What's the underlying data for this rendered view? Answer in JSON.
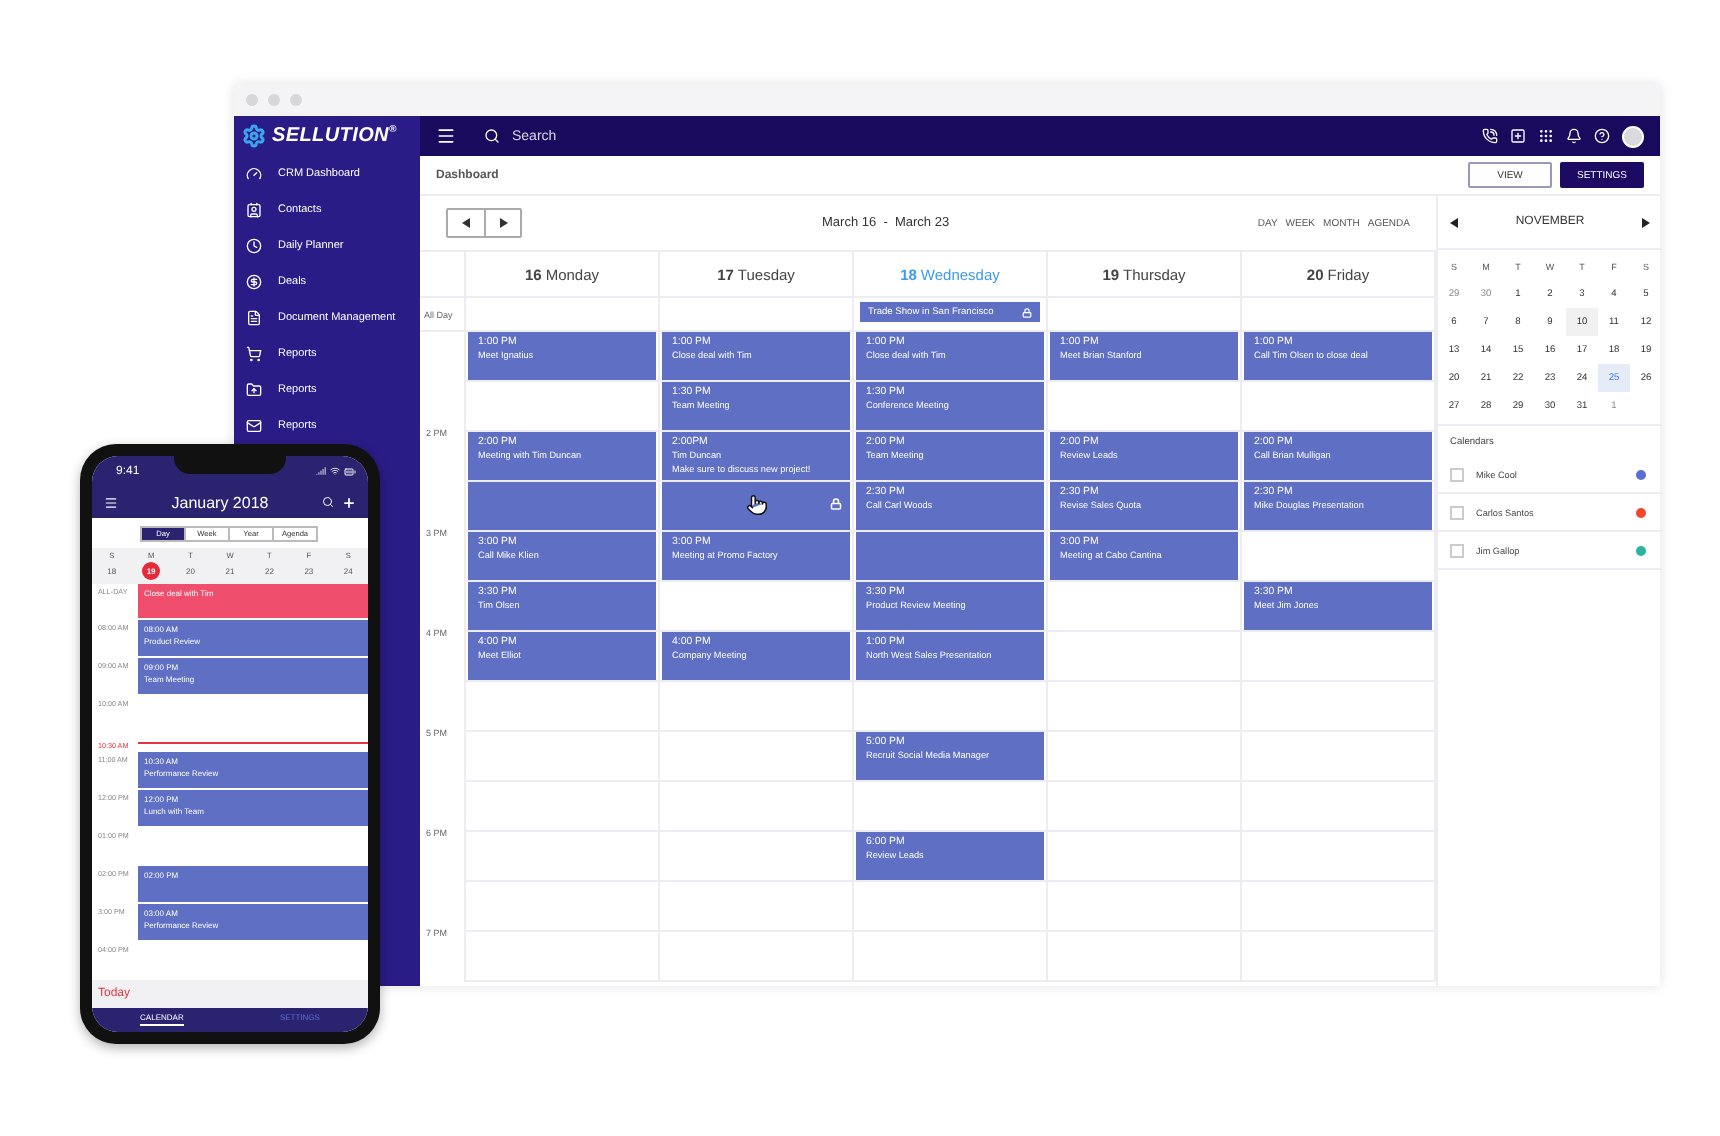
{
  "brand": {
    "name": "SELLUTION$^{®}$"
  },
  "search": {
    "placeholder": "Search"
  },
  "sidebar": {
    "items": [
      {
        "label": "CRM Dashboard"
      },
      {
        "label": "Contacts"
      },
      {
        "label": "Daily Planner"
      },
      {
        "label": "Deals"
      },
      {
        "label": "Document Management"
      },
      {
        "label": "Reports"
      },
      {
        "label": "Reports"
      },
      {
        "label": "Reports"
      }
    ]
  },
  "page_title": "Dashboard",
  "header_buttons": [
    {
      "label": "VIEW",
      "kind": "outline"
    },
    {
      "label": "SETTINGS",
      "kind": "filled"
    }
  ],
  "calendar": {
    "range": "March 16  -  March 23",
    "views": [
      {
        "label": "DAY",
        "selected": false
      },
      {
        "label": "WEEK",
        "selected": false
      },
      {
        "label": "MONTH",
        "selected": false
      },
      {
        "label": "AGENDA",
        "selected": false
      }
    ],
    "all_day_label": "All Day",
    "hour_labels": [
      "2 PM",
      "3 PM",
      "4 PM",
      "5 PM",
      "6 PM",
      "7 PM"
    ],
    "days": [
      {
        "number": "16",
        "name": "Monday",
        "today": false,
        "slots": [
          {
            "kind": "event",
            "time": "1:00 PM",
            "title": "Meet Ignatius"
          },
          {
            "kind": "empty"
          },
          {
            "kind": "event",
            "time": "2:00 PM",
            "title": "Meeting with Tim Duncan"
          },
          {
            "kind": "busy"
          },
          {
            "kind": "event",
            "time": "3:00 PM",
            "title": "Call  Mike Klien"
          },
          {
            "kind": "event",
            "time": "3:30 PM",
            "title": "Tim Olsen"
          },
          {
            "kind": "event",
            "time": "4:00 PM",
            "title": "Meet Elliot"
          },
          {
            "kind": "empty"
          },
          {
            "kind": "empty"
          },
          {
            "kind": "empty"
          },
          {
            "kind": "empty"
          },
          {
            "kind": "empty"
          },
          {
            "kind": "empty"
          }
        ]
      },
      {
        "number": "17",
        "name": "Tuesday",
        "today": false,
        "slots": [
          {
            "kind": "event",
            "time": "1:00 PM",
            "title": "Close deal with Tim"
          },
          {
            "kind": "event",
            "time": "1:30 PM",
            "title": "Team Meeting"
          },
          {
            "kind": "event",
            "time": "2:00PM",
            "title": "Tim Duncan",
            "note": "Make sure to discuss new project!"
          },
          {
            "kind": "locked"
          },
          {
            "kind": "event",
            "time": "3:00 PM",
            "title": "Meeting at Promo Factory"
          },
          {
            "kind": "empty"
          },
          {
            "kind": "event",
            "time": "4:00 PM",
            "title": "Company Meeting"
          },
          {
            "kind": "empty"
          },
          {
            "kind": "empty"
          },
          {
            "kind": "empty"
          },
          {
            "kind": "empty"
          },
          {
            "kind": "empty"
          },
          {
            "kind": "empty"
          }
        ]
      },
      {
        "number": "18",
        "name": "Wednesday",
        "today": true,
        "all_day": {
          "title": "Trade Show in San Francisco",
          "locked": true
        },
        "slots": [
          {
            "kind": "event",
            "time": "1:00 PM",
            "title": "Close deal with Tim"
          },
          {
            "kind": "event",
            "time": "1:30 PM",
            "title": "Conference Meeting"
          },
          {
            "kind": "event",
            "time": "2:00 PM",
            "title": "Team Meeting"
          },
          {
            "kind": "event",
            "time": "2:30 PM",
            "title": "Call Carl Woods"
          },
          {
            "kind": "busy"
          },
          {
            "kind": "event",
            "time": "3:30 PM",
            "title": "Product Review Meeting"
          },
          {
            "kind": "event",
            "time": "1:00 PM",
            "title": "North West Sales Presentation"
          },
          {
            "kind": "empty"
          },
          {
            "kind": "event",
            "time": "5:00 PM",
            "title": "Recruit Social Media Manager"
          },
          {
            "kind": "empty"
          },
          {
            "kind": "event",
            "time": "6:00 PM",
            "title": "Review Leads"
          },
          {
            "kind": "empty"
          },
          {
            "kind": "empty"
          }
        ]
      },
      {
        "number": "19",
        "name": "Thursday",
        "today": false,
        "slots": [
          {
            "kind": "event",
            "time": "1:00 PM",
            "title": "Meet Brian Stanford"
          },
          {
            "kind": "empty"
          },
          {
            "kind": "event",
            "time": "2:00 PM",
            "title": "Review Leads"
          },
          {
            "kind": "event",
            "time": "2:30 PM",
            "title": "Revise Sales Quota"
          },
          {
            "kind": "event",
            "time": "3:00 PM",
            "title": "Meeting at Cabo Cantina"
          },
          {
            "kind": "empty"
          },
          {
            "kind": "empty"
          },
          {
            "kind": "empty"
          },
          {
            "kind": "empty"
          },
          {
            "kind": "empty"
          },
          {
            "kind": "empty"
          },
          {
            "kind": "empty"
          },
          {
            "kind": "empty"
          }
        ]
      },
      {
        "number": "20",
        "name": "Friday",
        "today": false,
        "slots": [
          {
            "kind": "event",
            "time": "1:00 PM",
            "title": "Call Tim Olsen to close deal"
          },
          {
            "kind": "empty"
          },
          {
            "kind": "event",
            "time": "2:00 PM",
            "title": "Call Brian Mulligan"
          },
          {
            "kind": "event",
            "time": "2:30 PM",
            "title": "Mike Douglas Presentation"
          },
          {
            "kind": "empty"
          },
          {
            "kind": "event",
            "time": "3:30 PM",
            "title": "Meet Jim Jones"
          },
          {
            "kind": "empty"
          },
          {
            "kind": "empty"
          },
          {
            "kind": "empty"
          },
          {
            "kind": "empty"
          },
          {
            "kind": "empty"
          },
          {
            "kind": "empty"
          },
          {
            "kind": "empty"
          }
        ]
      }
    ]
  },
  "mini_calendar": {
    "month": "NOVEMBER",
    "weekdays": [
      "S",
      "M",
      "T",
      "W",
      "T",
      "F",
      "S"
    ],
    "weeks": [
      [
        {
          "day": "29",
          "muted": true,
          "shaded": false,
          "selected": false
        },
        {
          "day": "30",
          "muted": true,
          "shaded": false,
          "selected": false
        },
        {
          "day": "1",
          "muted": false,
          "shaded": false,
          "selected": false
        },
        {
          "day": "2",
          "muted": false,
          "shaded": false,
          "selected": false
        },
        {
          "day": "3",
          "muted": false,
          "shaded": false,
          "selected": false
        },
        {
          "day": "4",
          "muted": false,
          "shaded": false,
          "selected": false
        },
        {
          "day": "5",
          "muted": false,
          "shaded": false,
          "selected": false
        }
      ],
      [
        {
          "day": "6",
          "muted": false,
          "shaded": false,
          "selected": false
        },
        {
          "day": "7",
          "muted": false,
          "shaded": false,
          "selected": false
        },
        {
          "day": "8",
          "muted": false,
          "shaded": false,
          "selected": false
        },
        {
          "day": "9",
          "muted": false,
          "shaded": false,
          "selected": false
        },
        {
          "day": "10",
          "muted": false,
          "shaded": true,
          "selected": false
        },
        {
          "day": "11",
          "muted": false,
          "shaded": false,
          "selected": false
        },
        {
          "day": "12",
          "muted": false,
          "shaded": false,
          "selected": false
        }
      ],
      [
        {
          "day": "13",
          "muted": false,
          "shaded": false,
          "selected": false
        },
        {
          "day": "14",
          "muted": false,
          "shaded": false,
          "selected": false
        },
        {
          "day": "15",
          "muted": false,
          "shaded": false,
          "selected": false
        },
        {
          "day": "16",
          "muted": false,
          "shaded": false,
          "selected": false
        },
        {
          "day": "17",
          "muted": false,
          "shaded": false,
          "selected": false
        },
        {
          "day": "18",
          "muted": false,
          "shaded": false,
          "selected": false
        },
        {
          "day": "19",
          "muted": false,
          "shaded": false,
          "selected": false
        }
      ],
      [
        {
          "day": "20",
          "muted": false,
          "shaded": false,
          "selected": false
        },
        {
          "day": "21",
          "muted": false,
          "shaded": false,
          "selected": false
        },
        {
          "day": "22",
          "muted": false,
          "shaded": false,
          "selected": false
        },
        {
          "day": "23",
          "muted": false,
          "shaded": false,
          "selected": false
        },
        {
          "day": "24",
          "muted": false,
          "shaded": false,
          "selected": false
        },
        {
          "day": "25",
          "muted": false,
          "shaded": false,
          "selected": true
        },
        {
          "day": "26",
          "muted": false,
          "shaded": false,
          "selected": false
        }
      ],
      [
        {
          "day": "27",
          "muted": false,
          "shaded": false,
          "selected": false
        },
        {
          "day": "28",
          "muted": false,
          "shaded": false,
          "selected": false
        },
        {
          "day": "29",
          "muted": false,
          "shaded": false,
          "selected": false
        },
        {
          "day": "30",
          "muted": false,
          "shaded": false,
          "selected": false
        },
        {
          "day": "31",
          "muted": false,
          "shaded": false,
          "selected": false
        },
        {
          "day": "1",
          "muted": true,
          "shaded": false,
          "selected": false
        }
      ]
    ]
  },
  "calendars": {
    "title": "Calendars",
    "items": [
      {
        "name": "Mike Cool",
        "color": "#5b6fd0",
        "checked": false
      },
      {
        "name": "Carlos Santos",
        "color": "#f2452b",
        "checked": false
      },
      {
        "name": "Jim Gallop",
        "color": "#2bb3a0",
        "checked": false
      }
    ]
  },
  "phone": {
    "clock": "9:41",
    "title": "January 2018",
    "segments": [
      {
        "label": "Day",
        "selected": true
      },
      {
        "label": "Week",
        "selected": false
      },
      {
        "label": "Year",
        "selected": false
      },
      {
        "label": "Agenda",
        "selected": false
      }
    ],
    "week": [
      {
        "letter": "S",
        "date": "18",
        "selected": false
      },
      {
        "letter": "M",
        "date": "19",
        "selected": true
      },
      {
        "letter": "T",
        "date": "20",
        "selected": false
      },
      {
        "letter": "W",
        "date": "21",
        "selected": false
      },
      {
        "letter": "T",
        "date": "22",
        "selected": false
      },
      {
        "letter": "F",
        "date": "23",
        "selected": false
      },
      {
        "letter": "S",
        "date": "24",
        "selected": false
      }
    ],
    "timeline": [
      {
        "label": "ALL-DAY",
        "kind": "allday",
        "event": {
          "title": "Close deal with Tim"
        }
      },
      {
        "label": "08:00 AM",
        "kind": "slot",
        "event": {
          "time": "08:00 AM",
          "title": "Product Review"
        }
      },
      {
        "label": "09:00 AM",
        "kind": "slot",
        "event": {
          "time": "09:00 PM",
          "title": "Team Meeting"
        }
      },
      {
        "label": "10:00 AM",
        "kind": "slot"
      },
      {
        "label": "10:30 AM",
        "kind": "now"
      },
      {
        "label": "11:00 AM",
        "kind": "slot",
        "event": {
          "time": "10:30 AM",
          "title": "Performance Review"
        }
      },
      {
        "label": "12:00 PM",
        "kind": "slot",
        "event": {
          "time": "12:00 PM",
          "title": "Lunch with Team"
        }
      },
      {
        "label": "01:00 PM",
        "kind": "slot"
      },
      {
        "label": "02:00 PM",
        "kind": "slot",
        "event": {
          "time": "02:00 PM"
        }
      },
      {
        "label": "3:00 PM",
        "kind": "slot",
        "event": {
          "time": "03:00 AM",
          "title": "Performance Review"
        }
      },
      {
        "label": "04:00 PM",
        "kind": "slot"
      }
    ],
    "today": "Today",
    "tabs": [
      {
        "label": "CALENDAR",
        "selected": true
      },
      {
        "label": "SETTINGS",
        "selected": false
      }
    ]
  }
}
